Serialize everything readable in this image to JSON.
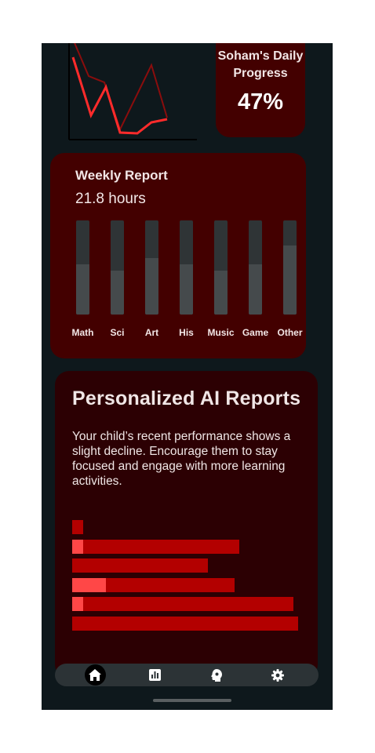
{
  "daily_progress": {
    "title": "Soham's Daily Progress",
    "percent": "47%"
  },
  "weekly_report": {
    "title": "Weekly Report",
    "hours": "21.8 hours",
    "subjects": [
      {
        "label": "Math",
        "level": 0.53
      },
      {
        "label": "Sci",
        "level": 0.47
      },
      {
        "label": "Art",
        "level": 0.6
      },
      {
        "label": "His",
        "level": 0.53
      },
      {
        "label": "Music",
        "level": 0.47
      },
      {
        "label": "Game",
        "level": 0.53
      },
      {
        "label": "Other",
        "level": 0.73
      }
    ]
  },
  "ai_reports": {
    "title": "Personalized AI Reports",
    "message": "Your child’s recent performance shows a slight decline. Encourage them to stay focused and engage with more learning activities.",
    "bars": [
      {
        "value": 0.05,
        "highlight": 0
      },
      {
        "value": 0.74,
        "highlight": 0.05
      },
      {
        "value": 0.6,
        "highlight": 0
      },
      {
        "value": 0.72,
        "highlight": 0.15
      },
      {
        "value": 0.98,
        "highlight": 0.05
      },
      {
        "value": 1.0,
        "highlight": 0
      }
    ]
  },
  "nav": [
    {
      "name": "home-icon",
      "active": true
    },
    {
      "name": "chart-icon",
      "active": false
    },
    {
      "name": "ai-brain-icon",
      "active": false
    },
    {
      "name": "gear-icon",
      "active": false
    }
  ],
  "colors": {
    "card": "#430000",
    "ai_card": "#2c0003",
    "bar": "#b30000",
    "bar_highlight": "#ff4747",
    "line": "#ff2b2b"
  }
}
